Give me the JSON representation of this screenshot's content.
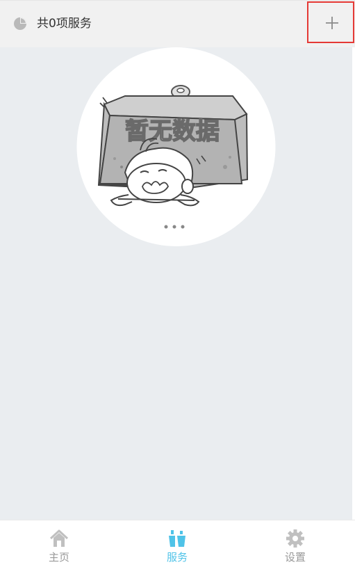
{
  "header": {
    "title": "共0项服务",
    "icon": "pie-chart-icon",
    "add_icon": "plus-icon"
  },
  "empty_state": {
    "text": "暂无数据",
    "image": "empty-state-character-under-block"
  },
  "tabbar": {
    "active_color": "#4fc3e8",
    "inactive_color": "#999999",
    "items": [
      {
        "label": "主页",
        "icon": "home-icon",
        "active": false
      },
      {
        "label": "服务",
        "icon": "service-icon",
        "active": true
      },
      {
        "label": "设置",
        "icon": "gear-icon",
        "active": false
      }
    ]
  }
}
